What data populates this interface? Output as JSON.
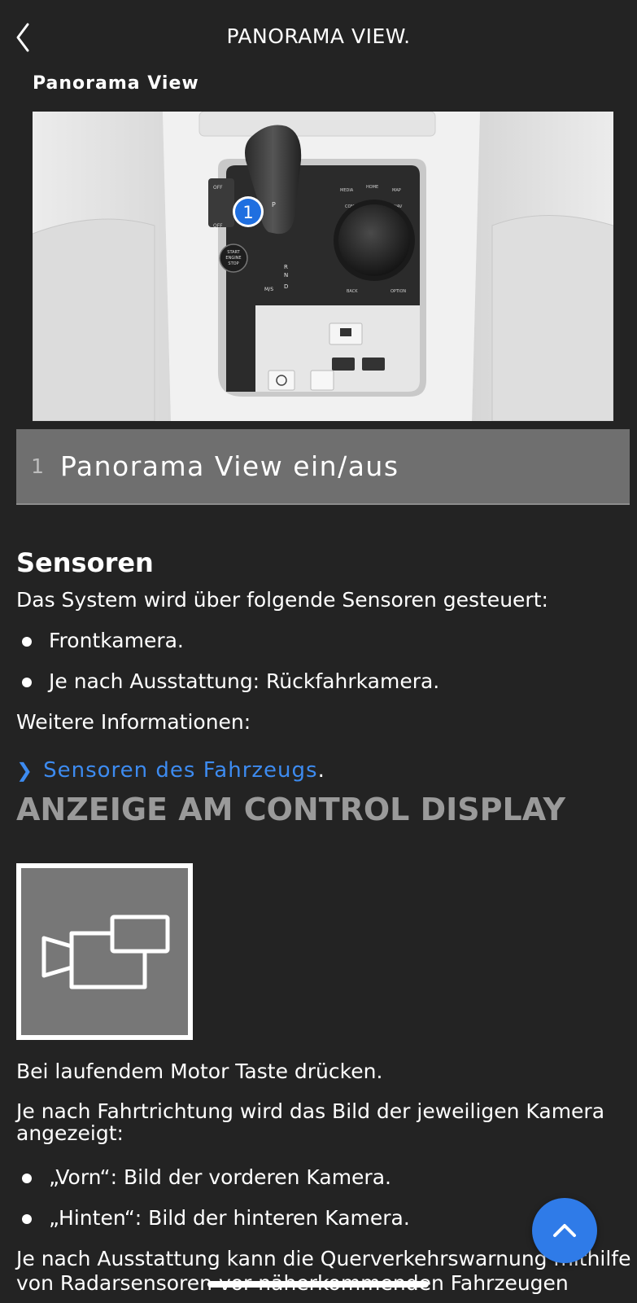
{
  "header": {
    "title": "PANORAMA VIEW.",
    "back_icon": "chevron-left-icon"
  },
  "figure": {
    "title": "Panorama View",
    "callout_number": "1",
    "console_labels": {
      "media": "MEDIA",
      "home": "HOME",
      "map": "MAP",
      "com": "COM",
      "nav": "NAV",
      "back": "BACK",
      "option": "OPTION",
      "start_line1": "START",
      "start_line2": "ENGINE",
      "start_line3": "STOP",
      "gear_p": "P",
      "gear_r": "R",
      "gear_n": "N",
      "gear_d": "D",
      "gear_ms": "M/S",
      "off1": "OFF",
      "off2": "OFF"
    }
  },
  "legend": {
    "number": "1",
    "label": "Panorama View ein/aus"
  },
  "sensoren": {
    "heading": "Sensoren",
    "intro": "Das System wird über folgende Sensoren gesteuert:",
    "bullets": [
      "Frontkamera.",
      "Je nach Ausstattung: Rückfahrkamera."
    ],
    "more_info": "Weitere Informationen:",
    "link_text": "Sensoren des Fahrzeugs",
    "link_suffix": "."
  },
  "anzeige": {
    "heading": "ANZEIGE AM CONTROL DISPLAY",
    "icon": "camera-view-icon",
    "press_text": "Bei laufendem Motor Taste drücken.",
    "direction_text": "Je nach Fahrtrichtung wird das Bild der jeweiligen Kamera angezeigt:",
    "bullets": [
      "„Vorn“: Bild der vorderen Kamera.",
      "„Hinten“: Bild der hinteren Kamera."
    ],
    "cut_text_line1": "Je nach Ausstattung kann die Querverkehrswarnung mithilfe",
    "cut_text_line2": "von Radarsensoren vor näherkommenden Fahrzeugen"
  },
  "fab": {
    "icon": "chevron-up-icon"
  },
  "colors": {
    "background": "#232323",
    "legend_bg": "#6f6f6f",
    "link": "#3d8bf0",
    "fab": "#2f7be8",
    "callout": "#1f6fe0"
  }
}
